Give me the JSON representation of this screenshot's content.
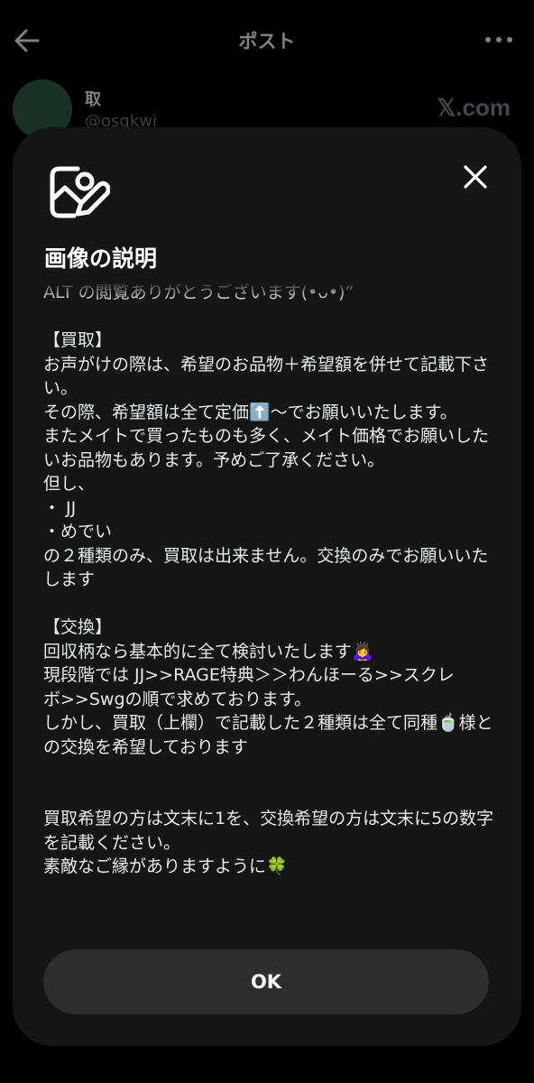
{
  "header": {
    "title": "ポスト"
  },
  "post": {
    "author_name": "取",
    "author_handle": "@osqkwi",
    "watermark": "𝕏.com"
  },
  "modal": {
    "heading": "画像の説明",
    "alt_text": "ALT の閲覧ありがとうございます(•ᴗ•)”\n\n【買取】\nお声がけの際は、希望のお品物＋希望額を併せて記載下さい。\nその際、希望額は全て定価⬆️〜でお願いいたします。\nまたメイトで買ったものも多く、メイト価格でお願いしたいお品物もあります。予めご了承ください。\n但し、\n・ JJ\n・めでい\nの２種類のみ、買取は出来ません。交換のみでお願いいたします\n\n【交換】\n回収柄なら基本的に全て検討いたします🙇‍♀️\n現段階では JJ>>RAGE特典＞＞わんほーる>>スクレ\nボ>>Swgの順で求めております。\nしかし、買取（上欄）で記載した２種類は全て同種🍵様との交換を希望しております\n\n\n買取希望の方は文末に1を、交換希望の方は文末に5の数字を記載ください。\n素敵なご縁がありますように🍀",
    "ok_label": "OK"
  },
  "colors": {
    "background": "#000000",
    "modal_background": "#161616",
    "ok_button": "#2e2e2e",
    "avatar": "#2f5b45",
    "text": "#e7e9ea"
  },
  "icons": {
    "back": "arrow-left-icon",
    "more": "more-horizontal-icon",
    "description": "image-description-icon",
    "close": "close-icon"
  }
}
